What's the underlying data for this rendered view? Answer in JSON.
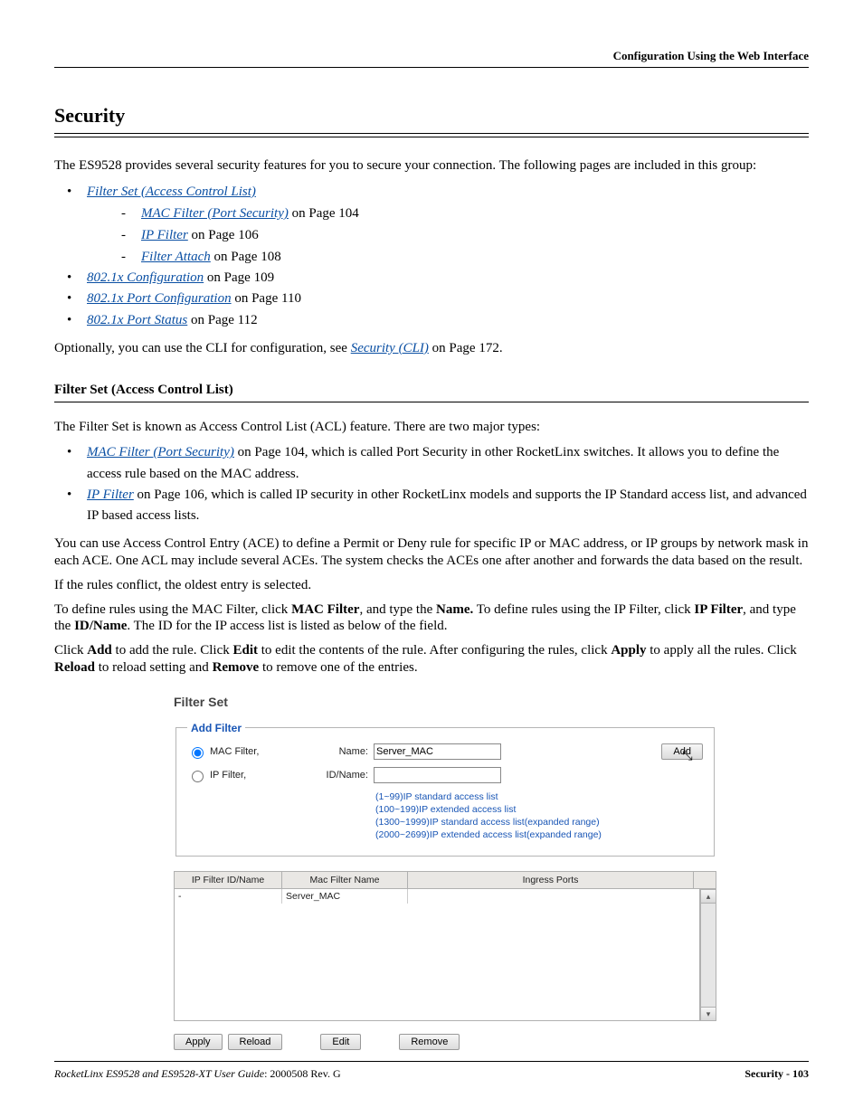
{
  "header": {
    "right": "Configuration Using the Web Interface"
  },
  "title": "Security",
  "intro": "The ES9528 provides several security features for you to secure your connection. The following pages are included in this group:",
  "links": {
    "filter_set": "Filter Set (Access Control List)",
    "mac_filter": "MAC Filter (Port Security)",
    "mac_filter_tail": " on Page 104",
    "ip_filter": "IP Filter",
    "ip_filter_tail": " on Page 106",
    "filter_attach": "Filter Attach",
    "filter_attach_tail": " on Page 108",
    "cfg_8021x": "802.1x Configuration",
    "cfg_8021x_tail": " on Page 109",
    "port_cfg_8021x": "802.1x Port Configuration",
    "port_cfg_8021x_tail": " on Page 110",
    "port_status_8021x": "802.1x Port Status",
    "port_status_8021x_tail": " on Page 112"
  },
  "optional_pre": "Optionally, you can use the CLI for configuration, see ",
  "optional_link": "Security (CLI)",
  "optional_post": " on Page 172.",
  "subheading": "Filter Set (Access Control List)",
  "p_acl_intro": "The Filter Set is known as Access Control List (ACL) feature. There are two major types:",
  "b1_link": "MAC Filter (Port Security)",
  "b1_tail": " on Page 104, which is called Port Security in other RocketLinx switches. It allows you to define the access rule based on the MAC address.",
  "b2_link": "IP Filter",
  "b2_tail": " on Page 106, which is called IP security in other RocketLinx models and supports the IP Standard access list, and advanced IP based access lists.",
  "p_ace": "You can use Access Control Entry (ACE) to define a Permit or Deny rule for specific IP or MAC address, or IP groups by network mask in each ACE. One ACL may include several ACEs. The system checks the ACEs one after another and forwards the data based on the result.",
  "p_conflict": "If the rules conflict, the oldest entry is selected.",
  "p_define_pre": "To define rules using the MAC Filter, click ",
  "p_define_mf": "MAC Filter",
  "p_define_mid1": ", and type the ",
  "p_define_name": "Name.",
  "p_define_mid2": " To define rules using the IP Filter, click ",
  "p_define_if": "IP Filter",
  "p_define_mid3": ", and type the ",
  "p_define_idname": "ID/Name",
  "p_define_tail": ". The ID for the IP access list is listed as below of the field.",
  "p_click_pre": "Click ",
  "p_click_add": "Add",
  "p_click_1": " to add the rule. Click ",
  "p_click_edit": "Edit",
  "p_click_2": " to edit the contents of the rule. After configuring the rules, click ",
  "p_click_apply": "Apply",
  "p_click_3": " to apply all the rules. Click ",
  "p_click_reload": "Reload",
  "p_click_4": " to reload setting and ",
  "p_click_remove": "Remove",
  "p_click_5": " to remove one of the entries.",
  "app": {
    "title": "Filter Set",
    "legend": "Add Filter",
    "mac_label": "MAC Filter,",
    "ip_label": "IP Filter,",
    "name_label": "Name:",
    "idname_label": "ID/Name:",
    "name_value": "Server_MAC",
    "idname_value": "",
    "add_btn": "Add",
    "hints": [
      "(1~99)IP standard access list",
      "(100~199)IP extended access list",
      "(1300~1999)IP standard access list(expanded range)",
      "(2000~2699)IP extended access list(expanded range)"
    ],
    "cols": {
      "c1": "IP Filter ID/Name",
      "c2": "Mac Filter Name",
      "c3": "Ingress Ports"
    },
    "rows": [
      {
        "ip": "-",
        "mac": "Server_MAC",
        "ing": ""
      }
    ],
    "buttons": {
      "apply": "Apply",
      "reload": "Reload",
      "edit": "Edit",
      "remove": "Remove"
    }
  },
  "footer": {
    "left_title": "RocketLinx ES9528 and ES9528-XT User Guide",
    "left_rev": ": 2000508 Rev. G",
    "right": "Security - 103"
  }
}
